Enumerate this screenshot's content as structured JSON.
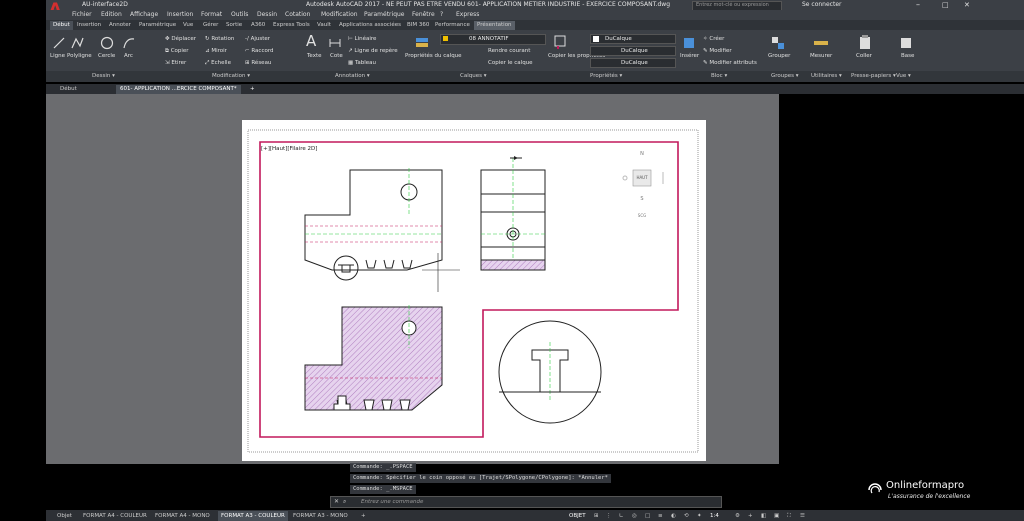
{
  "title_bar": {
    "app_menu_letter": "A",
    "workspace": "AU-interface2D",
    "title": "Autodesk AutoCAD 2017 - NE PEUT PAS ETRE VENDU    601- APPLICATION METIER INDUSTRIE - EXERCICE COMPOSANT.dwg",
    "search_placeholder": "Entrez mot-clé ou expression",
    "user": "Se connecter"
  },
  "menu": [
    "Fichier",
    "Edition",
    "Affichage",
    "Insertion",
    "Format",
    "Outils",
    "Dessin",
    "Cotation",
    "Modification",
    "Paramétrique",
    "Fenêtre",
    "?",
    "Express"
  ],
  "ribbon_tabs": [
    {
      "label": "Début",
      "active": true
    },
    {
      "label": "Insertion"
    },
    {
      "label": "Annoter"
    },
    {
      "label": "Paramétrique"
    },
    {
      "label": "Vue"
    },
    {
      "label": "Gérer"
    },
    {
      "label": "Sortie"
    },
    {
      "label": "A360"
    },
    {
      "label": "Express Tools"
    },
    {
      "label": "Vault"
    },
    {
      "label": "Applications associées"
    },
    {
      "label": "BIM 360"
    },
    {
      "label": "Performance"
    },
    {
      "label": "Présentation"
    }
  ],
  "ribbon": {
    "dessin": {
      "ligne": "Ligne",
      "polyligne": "Polyligne",
      "cercle": "Cercle",
      "arc": "Arc"
    },
    "modification": {
      "deplacer": "Déplacer",
      "rotation": "Rotation",
      "ajuster": "Ajuster",
      "copier": "Copier",
      "miroir": "Miroir",
      "raccord": "Raccord",
      "etirer": "Etirer",
      "echelle": "Echelle",
      "reseau": "Réseau"
    },
    "annotation": {
      "texte": "Texte",
      "cote": "Cote",
      "lineaire": "Linéaire",
      "ligne_repere": "Ligne de repère",
      "tableau": "Tableau"
    },
    "calques": {
      "proprietes": "Propriétés du calque",
      "layer": "08 ANNOTATIF",
      "rendre_courant": "Rendre courant",
      "copier_calque": "Copier le calque"
    },
    "proprietes": {
      "copier": "Copier les propriétés",
      "color": "DuCalque",
      "linetype": "DuCalque",
      "lineweight": "DuCalque"
    },
    "bloc": {
      "inserer": "Insérer",
      "creer": "Créer",
      "modifier": "Modifier",
      "modifier_attributs": "Modifier attributs"
    },
    "groupes": {
      "grouper": "Grouper"
    },
    "utilitaires": {
      "mesurer": "Mesurer"
    },
    "presse_papiers": {
      "coller": "Coller"
    },
    "vue": {
      "base": "Base"
    }
  },
  "panels": [
    "Dessin",
    "Modification",
    "Annotation",
    "Calques",
    "Propriétés",
    "Bloc",
    "Groupes",
    "Utilitaires",
    "Presse-papiers",
    "Vue"
  ],
  "doc_tabs": [
    "Début",
    "601- APPLICATION ...ERCICE COMPOSANT*"
  ],
  "viewport_label": "[+][Haut][Filaire 2D]",
  "viewcube": {
    "n": "N",
    "s": "S",
    "center": "HAUT",
    "wcs": "SCG"
  },
  "command_history": [
    "Commande:  _.PSPACE",
    "Commande: Spécifier le coin opposé ou [Trajet/SPolygone/CPolygone]: *Annuler*",
    "Commande:  _.MSPACE"
  ],
  "command_prompt": "Entrez une commande",
  "layout_tabs": [
    {
      "label": "Objet"
    },
    {
      "label": "FORMAT A4 - COULEUR"
    },
    {
      "label": "FORMAT A4 - MONO"
    },
    {
      "label": "FORMAT A3 - COULEUR",
      "active": true
    },
    {
      "label": "FORMAT A3 - MONO"
    }
  ],
  "status": {
    "space": "OBJET",
    "scale": "1:4"
  },
  "brand": {
    "name": "Onlineformapro",
    "tagline": "L'assurance de l'excellence"
  },
  "colors": {
    "accent": "#c2185b",
    "hatch": "#b07fc0",
    "center": "#2ecc40",
    "ribbon_bg": "#3c4046"
  }
}
